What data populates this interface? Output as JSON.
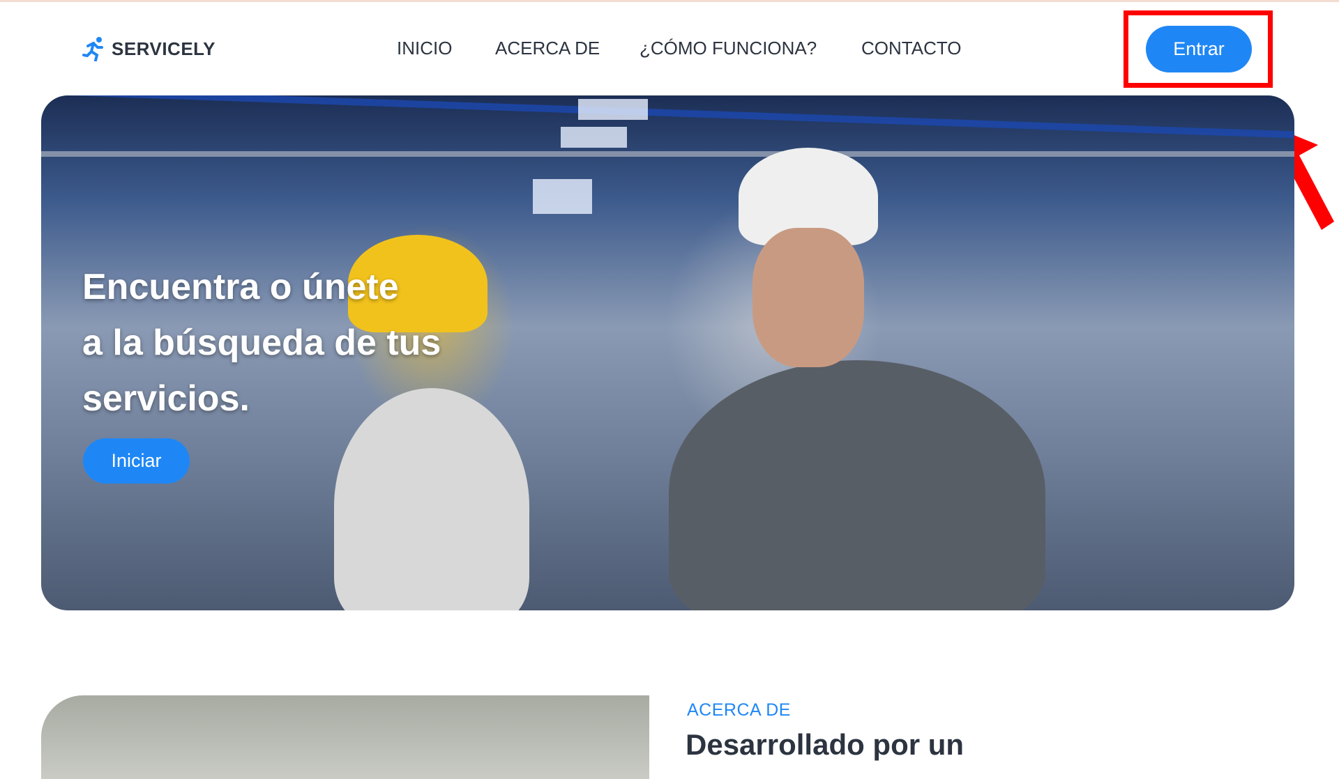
{
  "brand": {
    "name": "SERVICELY",
    "icon": "running-person-icon"
  },
  "nav": {
    "items": [
      "INICIO",
      "ACERCA DE",
      "¿CÓMO FUNCIONA?",
      "CONTACTO"
    ]
  },
  "header": {
    "login_label": "Entrar"
  },
  "hero": {
    "title_lines": [
      "Encuentra o únete",
      "a la búsqueda de tus",
      "servicios."
    ],
    "cta_label": "Iniciar"
  },
  "about": {
    "label": "ACERCA DE",
    "heading": "Desarrollado por un"
  },
  "colors": {
    "accent": "#1f87f5",
    "text": "#2c3440",
    "highlight": "#ff0000"
  }
}
